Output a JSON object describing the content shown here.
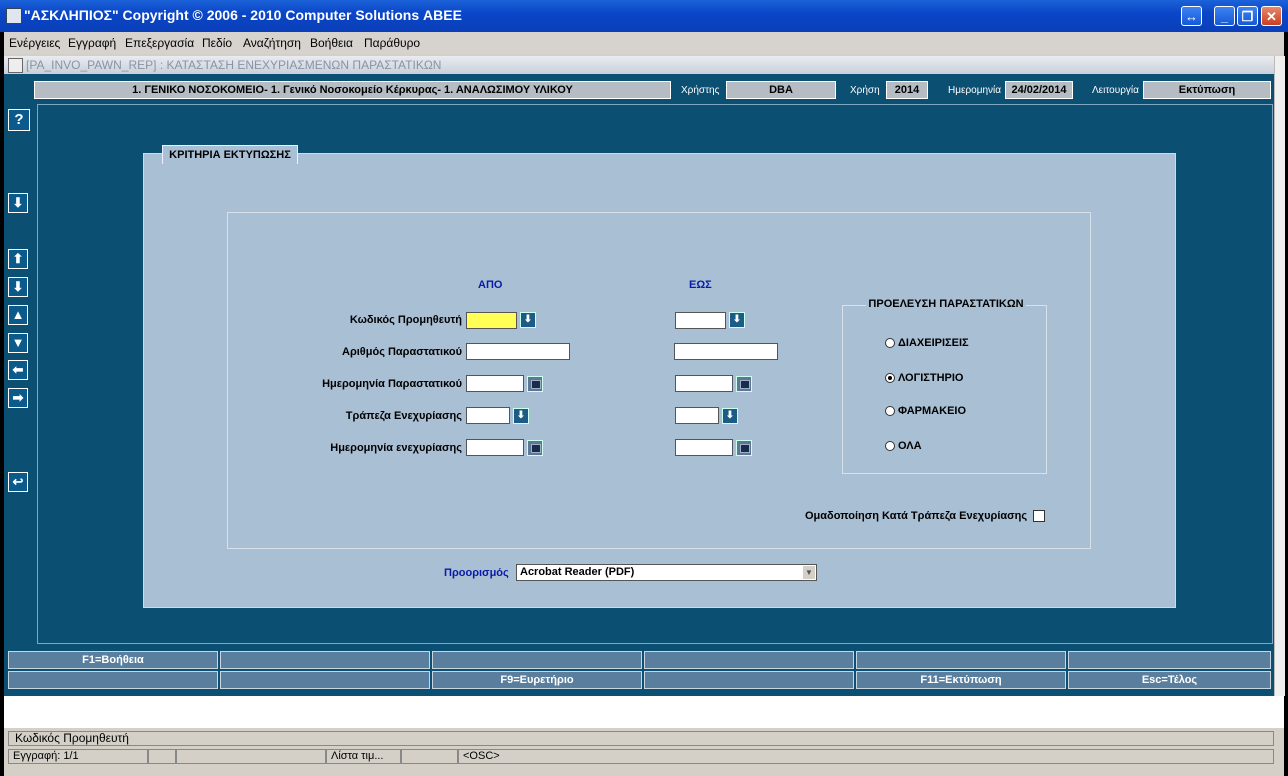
{
  "window": {
    "title": "\"ΑΣΚΛΗΠΙΟΣ\" Copyright © 2006 - 2010 Computer Solutions ΑΒΕΕ",
    "buttons": {
      "resize": "↔",
      "minimize": "_",
      "restore": "❐",
      "close": "✕"
    }
  },
  "menu": [
    "Ενέργειες",
    "Εγγραφή",
    "Επεξεργασία",
    "Πεδίο",
    "Αναζήτηση",
    "Βοήθεια",
    "Παράθυρο"
  ],
  "form_title": "[PA_INVO_PAWN_REP]  :  ΚΑΤΑΣΤΑΣΗ ΕΝΕΧΥΡΙΑΣΜΕΝΩΝ ΠΑΡΑΣΤΑΤΙΚΩΝ",
  "header": {
    "org": "1. ΓΕΝΙΚΟ ΝΟΣΟΚΟΜΕΙΟ- 1. Γενικό Νοσοκομείο Κέρκυρας- 1. ΑΝΑΛΩΣΙΜΟΥ ΥΛΙΚΟΥ",
    "user_label": "Χρήστης",
    "user": "DBA",
    "year_label": "Χρήση",
    "year": "2014",
    "date_label": "Ημερομηνία",
    "date": "24/02/2014",
    "function_label": "Λειτουργία",
    "function": "Εκτύπωση"
  },
  "side_buttons": {
    "help": "?",
    "lov": "⬇",
    "first": "⬆",
    "next": "⬇",
    "prev_rec": "▲",
    "next_rec": "▼",
    "left": "⬅",
    "right": "➡",
    "back": "↩"
  },
  "criteria": {
    "title": "ΚΡΙΤΗΡΙΑ ΕΚΤΥΠΩΣΗΣ",
    "from_label": "ΑΠΟ",
    "to_label": "ΕΩΣ",
    "rows": [
      {
        "label": "Κωδικός Προμηθευτή",
        "from": "",
        "to": ""
      },
      {
        "label": "Αριθμός Παραστατικού",
        "from": "",
        "to": ""
      },
      {
        "label": "Ημερομηνία Παραστατικού",
        "from": "",
        "to": ""
      },
      {
        "label": "Τράπεζα Ενεχυρίασης",
        "from": "",
        "to": ""
      },
      {
        "label": "Ημερομηνία ενεχυρίασης",
        "from": "",
        "to": ""
      }
    ],
    "origin": {
      "title": "ΠΡΟΕΛΕΥΣΗ ΠΑΡΑΣΤΑΤΙΚΩΝ",
      "options": [
        "ΔΙΑΧΕΙΡΙΣΕΙΣ",
        "ΛΟΓΙΣΤΗΡΙΟ",
        "ΦΑΡΜΑΚΕΙΟ",
        "ΟΛΑ"
      ],
      "selected": "ΛΟΓΙΣΤΗΡΙΟ"
    },
    "group_label": "Ομαδοποίηση Κατά Τράπεζα Ενεχυρίασης",
    "destination_label": "Προορισμός",
    "destination_value": "Acrobat Reader (PDF)"
  },
  "fkeys_row1": [
    "F1=Βοήθεια",
    "",
    "",
    "",
    "",
    ""
  ],
  "fkeys_row2": [
    "",
    "",
    "F9=Ευρετήριο",
    "",
    "F11=Εκτύπωση",
    "Esc=Τέλος"
  ],
  "status": {
    "hint": "Κωδικός Προμηθευτή",
    "record": "Εγγραφή: 1/1",
    "list": "Λίστα τιμ...",
    "osc": "<OSC>"
  }
}
